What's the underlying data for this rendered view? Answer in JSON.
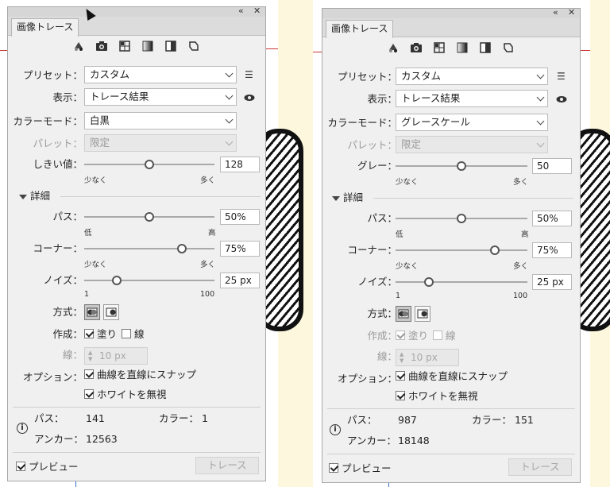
{
  "panels": [
    {
      "tab": "画像トレース",
      "preset": {
        "label": "プリセット：",
        "value": "カスタム"
      },
      "view": {
        "label": "表示：",
        "value": "トレース結果"
      },
      "mode": {
        "label": "カラーモード：",
        "value": "白黒"
      },
      "palette": {
        "label": "パレット：",
        "value": "限定"
      },
      "level": {
        "label": "しきい値：",
        "value": "128",
        "min": "少なく",
        "max": "多く",
        "pos": 0.5
      },
      "advanced": "詳細",
      "paths": {
        "label": "パス：",
        "value": "50%",
        "min": "低",
        "max": "高",
        "pos": 0.5
      },
      "corners": {
        "label": "コーナー：",
        "value": "75%",
        "min": "少なく",
        "max": "多く",
        "pos": 0.75
      },
      "noise": {
        "label": "ノイズ：",
        "value": "25 px",
        "min": "1",
        "max": "100",
        "pos": 0.25
      },
      "method": {
        "label": "方式："
      },
      "create": {
        "label": "作成：",
        "fill": "塗り",
        "stroke": "線"
      },
      "stroke": {
        "label": "線：",
        "value": "10 px"
      },
      "options": {
        "label": "オプション：",
        "snap": "曲線を直線にスナップ",
        "ignore_white": "ホワイトを無視"
      },
      "stats": {
        "paths_label": "パス：",
        "paths": "141",
        "colors_label": "カラー：",
        "colors": "1",
        "anchors_label": "アンカー：",
        "anchors": "12563"
      },
      "preview": "プレビュー",
      "trace": "トレース"
    },
    {
      "tab": "画像トレース",
      "preset": {
        "label": "プリセット：",
        "value": "カスタム"
      },
      "view": {
        "label": "表示：",
        "value": "トレース結果"
      },
      "mode": {
        "label": "カラーモード：",
        "value": "グレースケール"
      },
      "palette": {
        "label": "パレット：",
        "value": "限定"
      },
      "level": {
        "label": "グレー：",
        "value": "50",
        "min": "少なく",
        "max": "多く",
        "pos": 0.5
      },
      "advanced": "詳細",
      "paths": {
        "label": "パス：",
        "value": "50%",
        "min": "低",
        "max": "高",
        "pos": 0.5
      },
      "corners": {
        "label": "コーナー：",
        "value": "75%",
        "min": "少なく",
        "max": "多く",
        "pos": 0.75
      },
      "noise": {
        "label": "ノイズ：",
        "value": "25 px",
        "min": "1",
        "max": "100",
        "pos": 0.25
      },
      "method": {
        "label": "方式："
      },
      "create": {
        "label": "作成：",
        "fill": "塗り",
        "stroke": "線"
      },
      "stroke": {
        "label": "線：",
        "value": "10 px"
      },
      "options": {
        "label": "オプション：",
        "snap": "曲線を直線にスナップ",
        "ignore_white": "ホワイトを無視"
      },
      "stats": {
        "paths_label": "パス：",
        "paths": "987",
        "colors_label": "カラー：",
        "colors": "151",
        "anchors_label": "アンカー：",
        "anchors": "18148"
      },
      "preview": "プレビュー",
      "trace": "トレース"
    }
  ],
  "icons": {
    "collapse": "«",
    "close": "✕",
    "menu": "☰",
    "eye": "eye-icon",
    "info": "i"
  }
}
